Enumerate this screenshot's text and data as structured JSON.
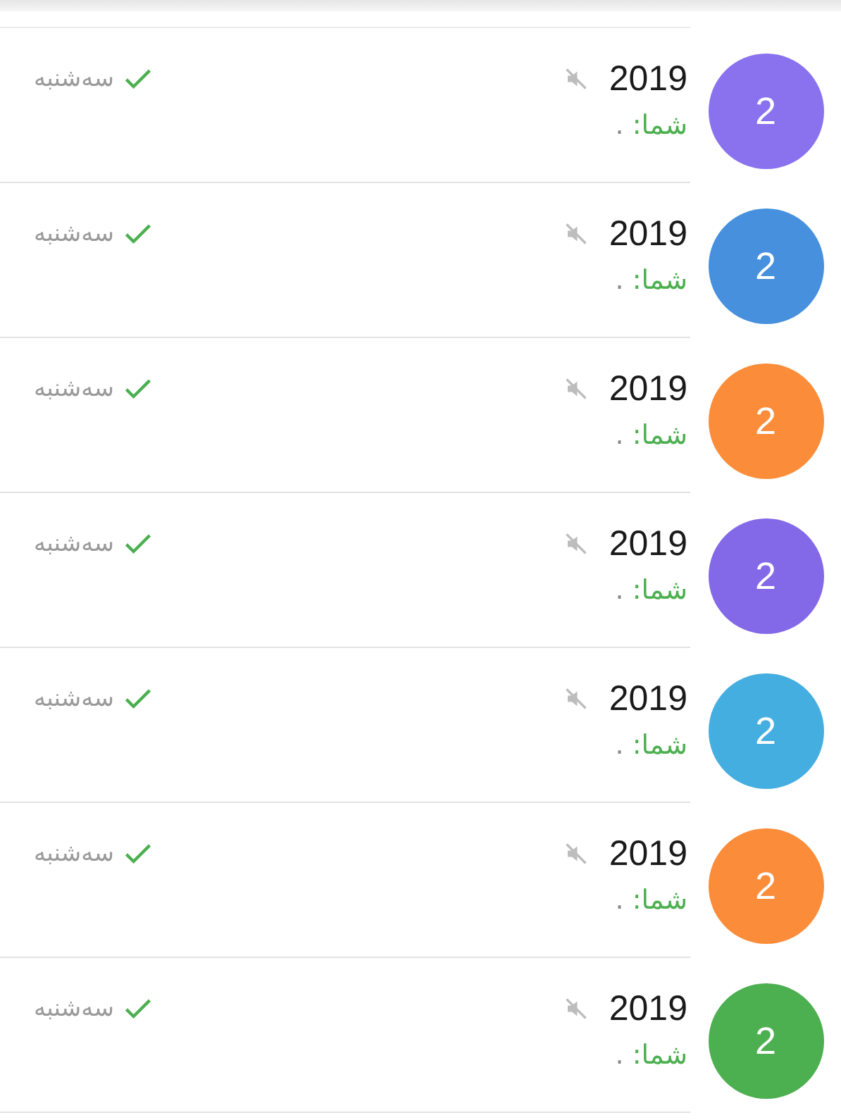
{
  "chats": [
    {
      "title": "2019",
      "avatar": "2",
      "color": "#8a72ee",
      "muted": true,
      "sender": "شما:",
      "text": ".",
      "read": true,
      "date": "سەشنبە"
    },
    {
      "title": "2019",
      "avatar": "2",
      "color": "#4690de",
      "muted": true,
      "sender": "شما:",
      "text": ".",
      "read": true,
      "date": "سەشنبە"
    },
    {
      "title": "2019",
      "avatar": "2",
      "color": "#fb8d3a",
      "muted": true,
      "sender": "شما:",
      "text": ".",
      "read": true,
      "date": "سەشنبە"
    },
    {
      "title": "2019",
      "avatar": "2",
      "color": "#8368e8",
      "muted": true,
      "sender": "شما:",
      "text": ".",
      "read": true,
      "date": "سەشنبە"
    },
    {
      "title": "2019",
      "avatar": "2",
      "color": "#45aee0",
      "muted": true,
      "sender": "شما:",
      "text": ".",
      "read": true,
      "date": "سەشنبە"
    },
    {
      "title": "2019",
      "avatar": "2",
      "color": "#fb8d3a",
      "muted": true,
      "sender": "شما:",
      "text": ".",
      "read": true,
      "date": "سەشنبە"
    },
    {
      "title": "2019",
      "avatar": "2",
      "color": "#4caf50",
      "muted": true,
      "sender": "شما:",
      "text": ".",
      "read": true,
      "date": "سەشنبە"
    }
  ]
}
